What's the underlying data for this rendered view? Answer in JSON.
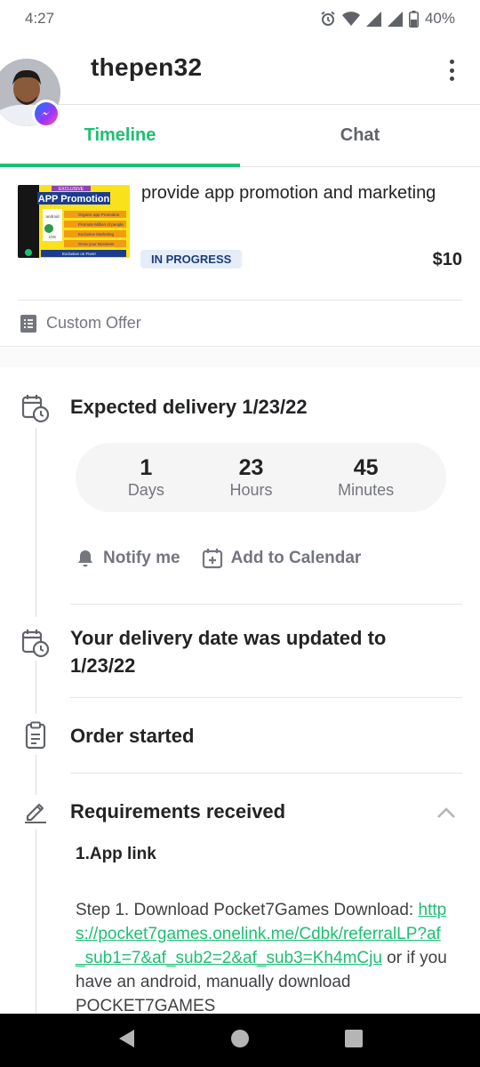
{
  "status_bar": {
    "time": "4:27",
    "battery": "40%",
    "icons": [
      "alarm-icon",
      "wifi-icon",
      "signal-icon",
      "signal-icon",
      "battery-icon"
    ]
  },
  "header": {
    "username": "thepen32",
    "avatar_icon": "avatar",
    "badge_icon": "messenger-icon",
    "menu_icon": "more-vertical-icon"
  },
  "tabs": [
    {
      "label": "Timeline",
      "active": true
    },
    {
      "label": "Chat",
      "active": false
    }
  ],
  "order": {
    "thumb": {
      "tag": "EXCLUSIVE",
      "title": "APP Promotion",
      "bullets": [
        "Organic app Promotion",
        "Promote Million of people",
        "Exclusive Marketing",
        "Grow your Business"
      ],
      "store_labels": [
        "android",
        "IOS"
      ],
      "footer": "Exclusive on Fiverr"
    },
    "title": "provide app promotion and marketing",
    "status": "IN PROGRESS",
    "price": "$10"
  },
  "custom_offer": {
    "label": "Custom Offer",
    "icon": "offer-list-icon"
  },
  "timeline": {
    "expected": {
      "title": "Expected delivery 1/23/22",
      "icon": "calendar-clock-icon",
      "countdown": [
        {
          "value": "1",
          "unit": "Days"
        },
        {
          "value": "23",
          "unit": "Hours"
        },
        {
          "value": "45",
          "unit": "Minutes"
        }
      ],
      "actions": [
        {
          "label": "Notify me",
          "icon": "bell-icon"
        },
        {
          "label": "Add to Calendar",
          "icon": "calendar-plus-icon"
        }
      ]
    },
    "updated": {
      "title": "Your delivery date was updated to 1/23/22",
      "icon": "calendar-clock-icon"
    },
    "started": {
      "title": "Order started",
      "icon": "clipboard-icon"
    },
    "requirements": {
      "title": "Requirements received",
      "icon": "pencil-icon",
      "chevron_icon": "chevron-up-icon",
      "question": "1.App link",
      "answer_prefix": "Step 1. Download Pocket7Games Download: ",
      "link": "https://pocket7games.onelink.me/Cdbk/referralLP?af_sub1=7&af_sub2=2&af_sub3=Kh4mCju",
      "answer_suffix": " or if you have an android, manually download POCKET7GAMES"
    }
  },
  "nav_bar": {
    "buttons": [
      {
        "name": "back-button",
        "icon": "triangle-back-icon"
      },
      {
        "name": "home-button",
        "icon": "circle-home-icon"
      },
      {
        "name": "recents-button",
        "icon": "square-recents-icon"
      }
    ]
  }
}
